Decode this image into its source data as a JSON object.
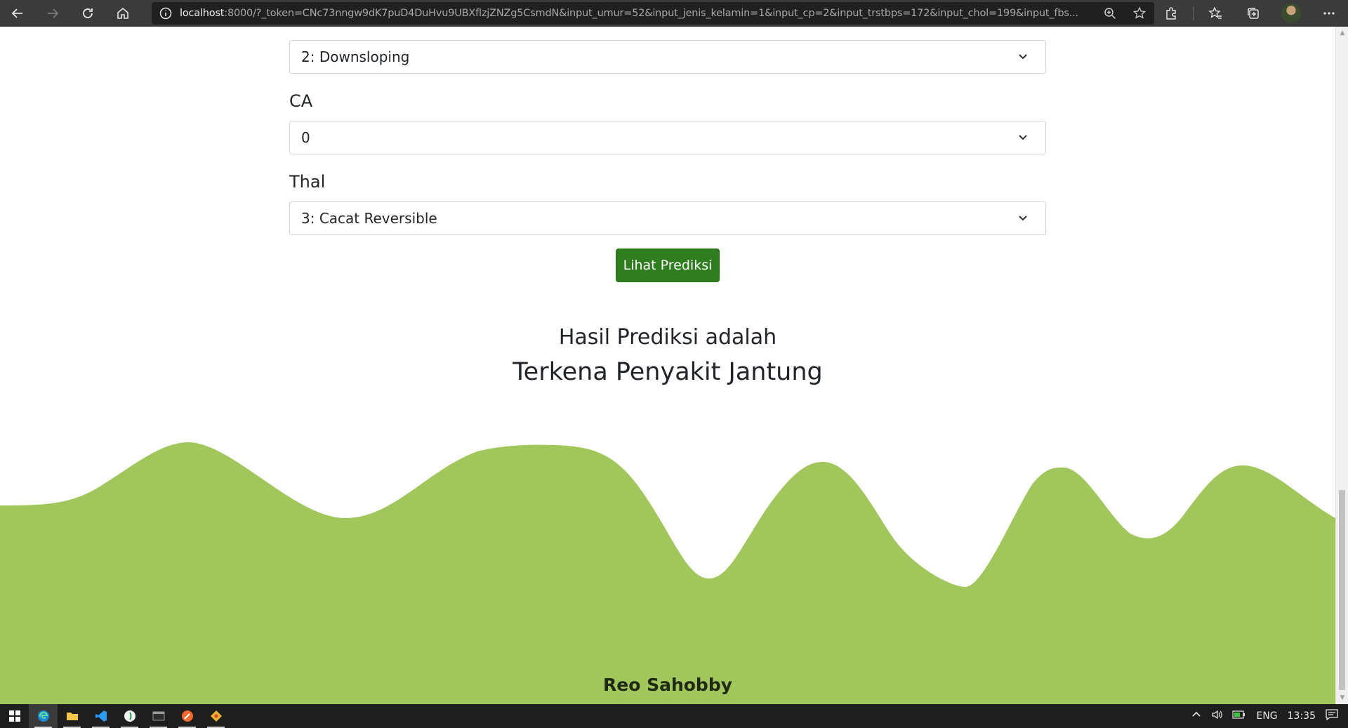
{
  "browser": {
    "url_host": "localhost",
    "url_rest": ":8000/?_token=CNc73nngw9dK7puD4DuHvu9UBXflzjZNZg5CsmdN&input_umur=52&input_jenis_kelamin=1&input_cp=2&input_trstbps=172&input_chol=199&input_fbs..."
  },
  "form": {
    "fields": [
      {
        "label": "CA",
        "value": "0"
      },
      {
        "label": "Thal",
        "value": "3: Cacat Reversible"
      }
    ],
    "slope_value": "2: Downsloping",
    "submit_label": "Lihat Prediksi"
  },
  "result": {
    "title": "Hasil Prediksi adalah",
    "value": "Terkena Penyakit Jantung"
  },
  "footer": {
    "name": "Reo Sahobby",
    "wave_color": "#a1c65c"
  },
  "taskbar": {
    "language": "ENG",
    "time": "13:35"
  },
  "colors": {
    "button": "#2e7d1e",
    "chrome": "#3b3b3b",
    "taskbar": "#1e1e1e"
  }
}
